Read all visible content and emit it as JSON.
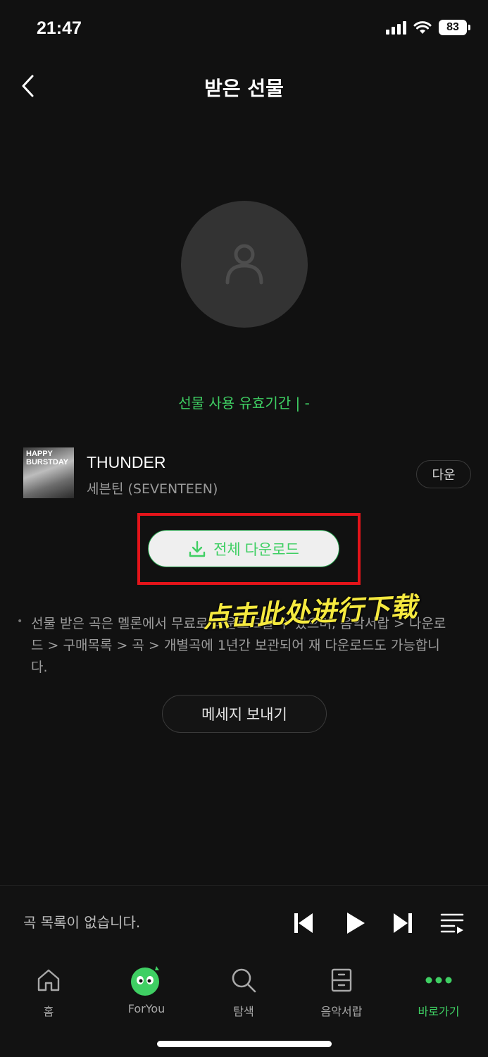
{
  "status_bar": {
    "time": "21:47",
    "battery": "83"
  },
  "header": {
    "title": "받은 선물"
  },
  "gift": {
    "validity": "선물 사용 유효기간  |   -"
  },
  "song": {
    "thumb_text": "HAPPY BURSTDAY",
    "title": "THUNDER",
    "artist": "세븐틴 (SEVENTEEN)",
    "download_label": "다운"
  },
  "download_all_label": "전체 다운로드",
  "annotation": "点击此处进行下载",
  "notice": "선물 받은 곡은 멜론에서 무료로 다운로드할 수 있으며, 음악서랍 > 다운로드 > 구매목록 > 곡 > 개별곡에 1년간 보관되어 재 다운로드도 가능합니다.",
  "send_message_label": "메세지 보내기",
  "player": {
    "status": "곡 목록이 없습니다."
  },
  "tabs": [
    {
      "label": "홈",
      "icon": "home-icon"
    },
    {
      "label": "ForYou",
      "icon": "foryou-mascot-icon"
    },
    {
      "label": "탐색",
      "icon": "search-icon"
    },
    {
      "label": "음악서랍",
      "icon": "drawer-icon"
    },
    {
      "label": "바로가기",
      "icon": "more-dots-icon",
      "active": true
    }
  ],
  "colors": {
    "accent_green": "#3fcf63",
    "highlight_red": "#e4141a",
    "annotation_yellow": "#f5e93f",
    "background": "#111111"
  }
}
